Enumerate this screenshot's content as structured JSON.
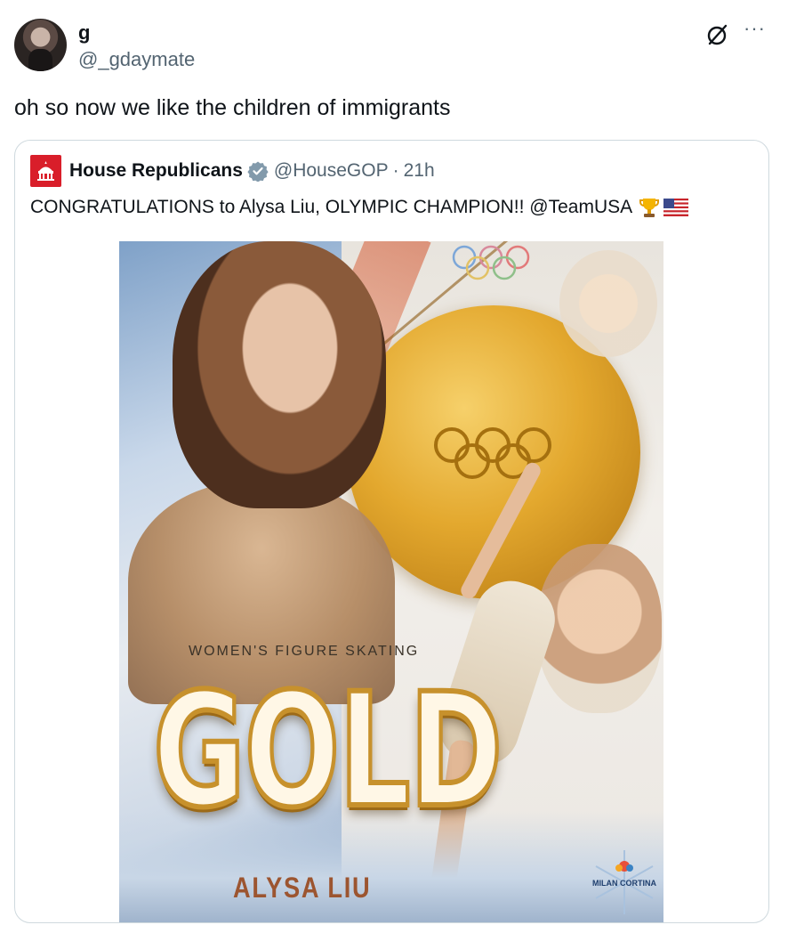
{
  "tweet": {
    "author_name": "g",
    "author_handle": "@_gdaymate",
    "text": "oh so now we like the children of immigrants",
    "more_label": "···"
  },
  "quoted_tweet": {
    "author_name": "House Republicans",
    "author_handle": "@HouseGOP",
    "separator": "·",
    "time": "21h",
    "text": "CONGRATULATIONS to Alysa Liu, OLYMPIC CHAMPION!! @TeamUSA",
    "emojis": [
      "trophy-icon",
      "us-flag-icon"
    ],
    "image": {
      "category": "WOMEN'S FIGURE SKATING",
      "headline": "GOLD",
      "athlete": "ALYSA LIU",
      "logo_text": "MILAN CORTINA"
    }
  },
  "colors": {
    "primary_text": "#0f1419",
    "secondary_text": "#536471",
    "border": "#cfd9de",
    "verified": "#829aab",
    "brand_red": "#d91e2a"
  }
}
